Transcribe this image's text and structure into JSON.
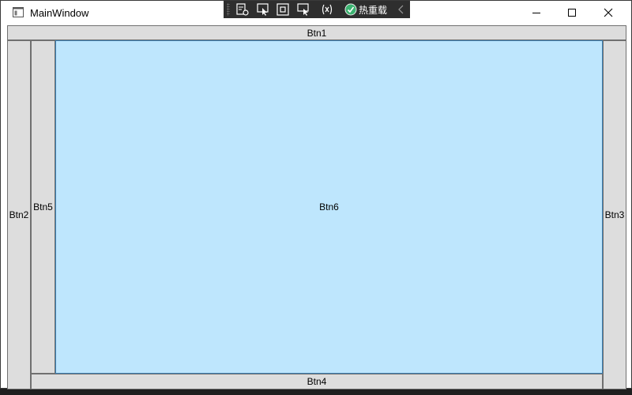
{
  "window": {
    "title": "MainWindow"
  },
  "debug_toolbar": {
    "hot_reload_label": "热重载",
    "icons": [
      "live-visual-tree-icon",
      "select-element-icon",
      "display-layout-adorners-icon",
      "track-focus-icon",
      "binding-failures-icon",
      "hot-reload-status-icon",
      "collapse-chevron-icon"
    ]
  },
  "buttons": {
    "btn1": "Btn1",
    "btn2": "Btn2",
    "btn3": "Btn3",
    "btn4": "Btn4",
    "btn5": "Btn5",
    "btn6": "Btn6"
  },
  "colors": {
    "button_face": "#dddddd",
    "button_border": "#707070",
    "hover_face": "#bee6fd",
    "hover_border": "#3c7fb1",
    "toolbar_bg": "#2e2e2e",
    "hot_reload_ok": "#3cb371"
  }
}
